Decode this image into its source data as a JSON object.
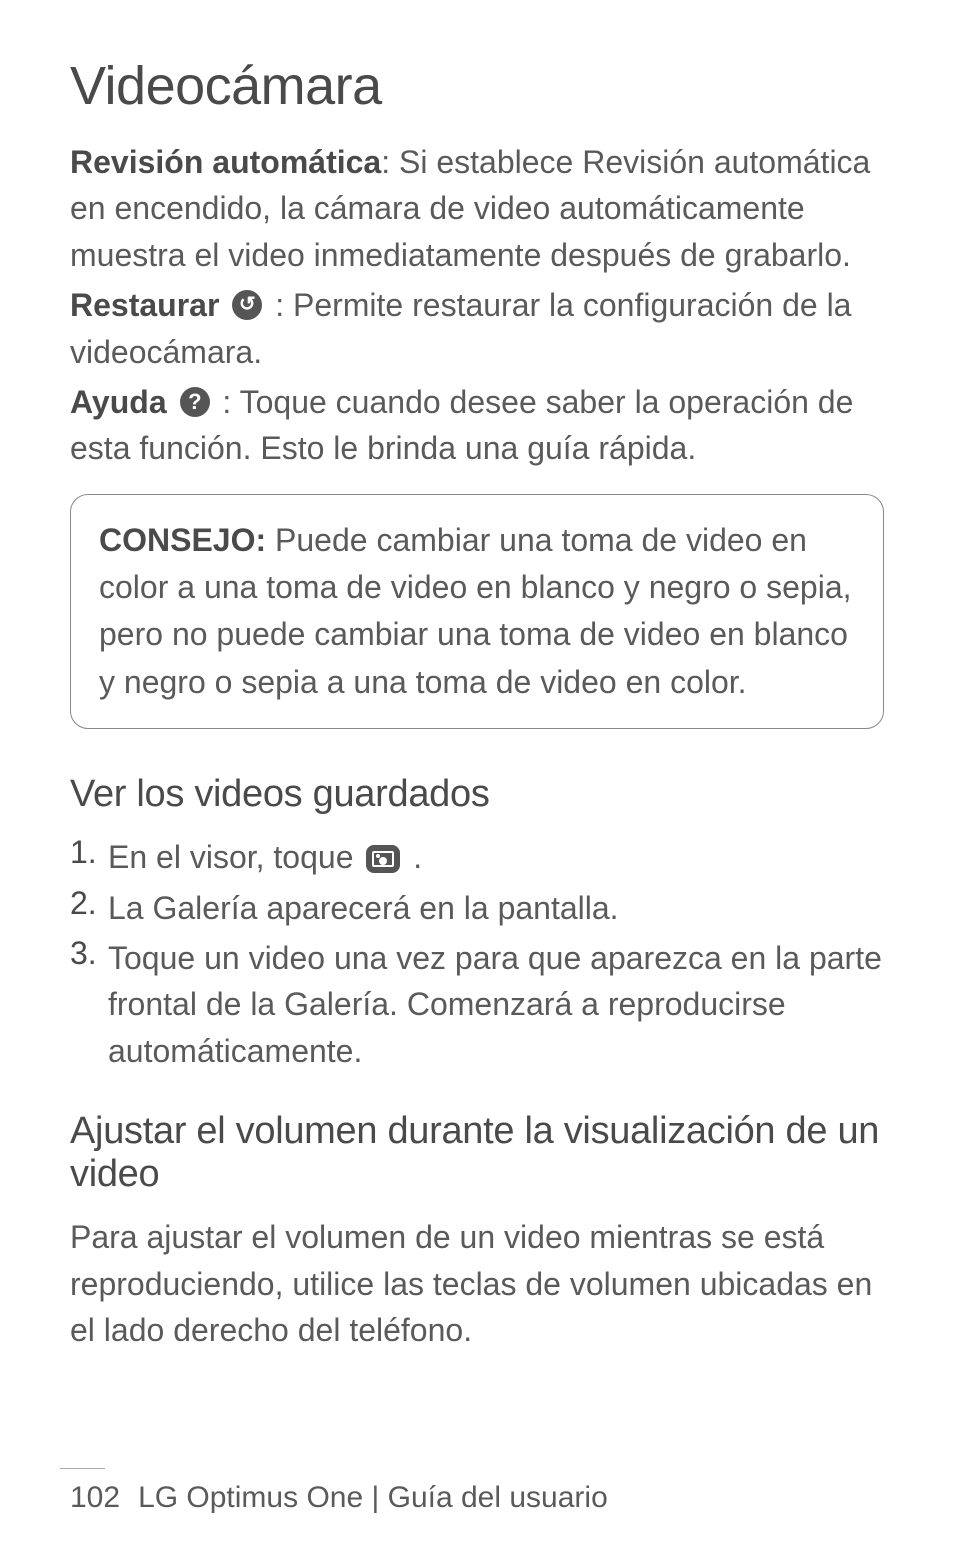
{
  "title": "Videocámara",
  "paragraphs": {
    "auto_review_label": "Revisión automática",
    "auto_review_text": ": Si establece Revisión automática en encendido, la cámara de video automáticamente muestra el video inmediatamente después de grabarlo.",
    "restore_label": "Restaurar",
    "restore_text": " : Permite restaurar la configuración de la videocámara.",
    "help_label": "Ayuda",
    "help_text": " : Toque cuando desee saber la operación de esta función. Esto le brinda una guía rápida."
  },
  "tip": {
    "label": "CONSEJO:",
    "text": " Puede cambiar una toma de video en color a una toma de video en blanco y negro o sepia, pero no puede cambiar una toma de video en blanco y negro o sepia a una toma de video en color."
  },
  "section1": {
    "heading": "Ver los videos guardados",
    "items": [
      {
        "num": "1.",
        "text_before": " En el visor, toque ",
        "text_after": " ."
      },
      {
        "num": "2.",
        "text": "La Galería aparecerá en la pantalla."
      },
      {
        "num": "3.",
        "text": "Toque un video una vez para que aparezca en la parte frontal de la Galería. Comenzará a reproducirse automáticamente."
      }
    ]
  },
  "section2": {
    "heading": "Ajustar el volumen durante la visualización de un video",
    "text": "Para ajustar el volumen de un video mientras se está reproduciendo, utilice las teclas de volumen ubicadas en el lado derecho del teléfono."
  },
  "footer": {
    "page": "102",
    "doc": "LG Optimus One | Guía del usuario"
  }
}
